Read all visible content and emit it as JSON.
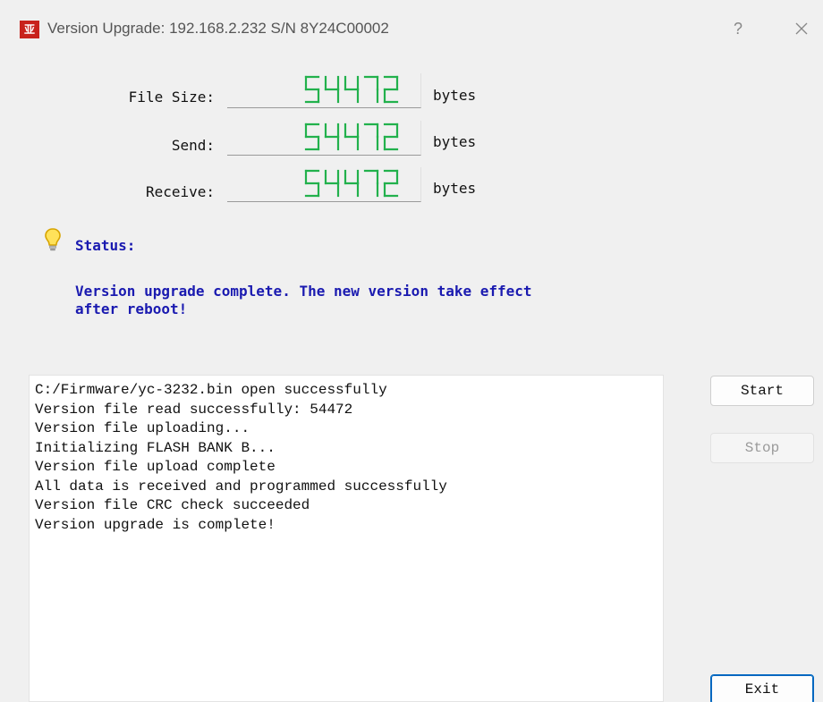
{
  "window": {
    "icon_glyph": "亚",
    "title": "Version Upgrade: 192.168.2.232  S/N 8Y24C00002",
    "help_label": "?"
  },
  "fields": [
    {
      "label": "File Size:",
      "value": "54472",
      "unit": "bytes"
    },
    {
      "label": "Send:",
      "value": "54472",
      "unit": "bytes"
    },
    {
      "label": "Receive:",
      "value": "54472",
      "unit": "bytes"
    }
  ],
  "status": {
    "title": "Status:",
    "line1": "Version upgrade complete. The new version take effect",
    "line2": "after reboot!"
  },
  "log": {
    "lines": [
      "C:/Firmware/yc-3232.bin open successfully",
      "Version file read successfully: 54472",
      "Version file uploading...",
      "Initializing FLASH BANK B...",
      "Version file upload complete",
      "All data is received and programmed successfully",
      "Version file CRC check succeeded",
      "Version upgrade is complete!"
    ]
  },
  "buttons": {
    "start": "Start",
    "stop": "Stop",
    "exit": "Exit"
  },
  "colors": {
    "lcd_digit": "#22b14c",
    "status_text": "#1a1ab0",
    "icon_bg": "#c8221c",
    "focus_border": "#0067c0"
  }
}
